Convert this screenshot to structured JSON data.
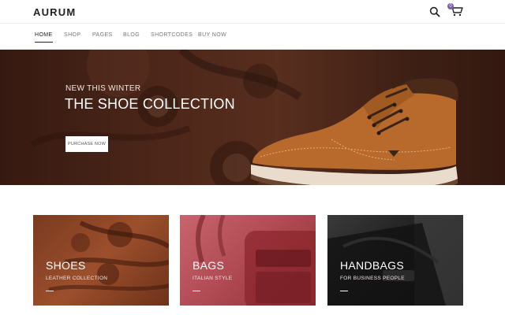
{
  "brand": {
    "logo": "AURUM"
  },
  "header": {
    "search_icon": "search-icon",
    "cart_icon": "cart-icon",
    "cart_count": "0",
    "badge_color": "#7b5ea7"
  },
  "nav": {
    "items": [
      {
        "label": "HOME",
        "active": true
      },
      {
        "label": "SHOP"
      },
      {
        "label": "PAGES"
      },
      {
        "label": "BLOG"
      },
      {
        "label": "SHORTCODES"
      },
      {
        "label": "BUY NOW"
      }
    ]
  },
  "hero": {
    "eyebrow": "NEW THIS WINTER",
    "title": "THE SHOE COLLECTION",
    "cta_label": "PURCHASE NOW"
  },
  "categories": [
    {
      "title": "SHOES",
      "subtitle": "LEATHER COLLECTION"
    },
    {
      "title": "BAGS",
      "subtitle": "ITALIAN STYLE"
    },
    {
      "title": "HANDBAGS",
      "subtitle": "FOR BUSINESS PEOPLE"
    }
  ]
}
